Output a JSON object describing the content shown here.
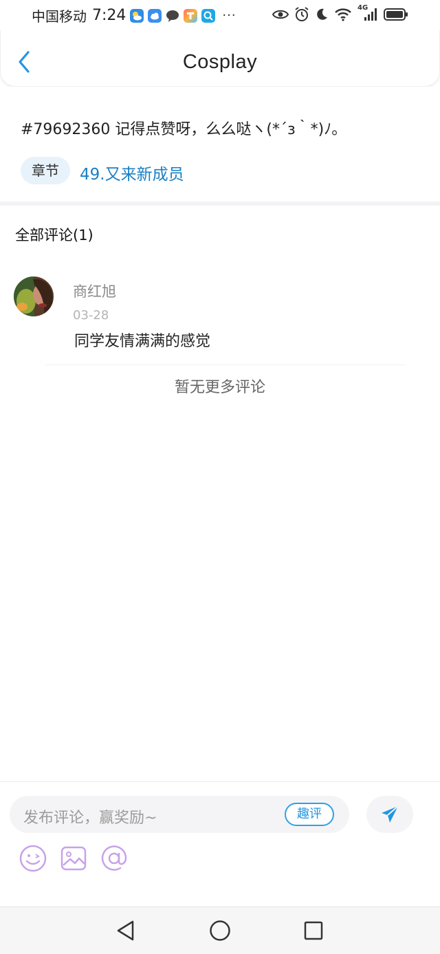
{
  "status_bar": {
    "carrier": "中国移动",
    "time": "7:24",
    "overflow": "···",
    "network": "4G"
  },
  "header": {
    "title": "Cosplay",
    "back_icon": "chevron-left-icon"
  },
  "post": {
    "text": "#79692360 记得点赞呀，么么哒ヽ(*´з｀*)ﾉ。",
    "chapter_tag": "章节",
    "chapter_link": "49.又来新成员"
  },
  "comments": {
    "title": "全部评论(1)",
    "items": [
      {
        "name": "商红旭",
        "date": "03-28",
        "text": "同学友情满满的感觉"
      }
    ],
    "no_more": "暂无更多评论"
  },
  "compose": {
    "placeholder": "发布评论，赢奖励~",
    "quick_comment": "趣评",
    "tools": [
      "emoji-icon",
      "image-icon",
      "mention-icon"
    ]
  },
  "colors": {
    "accent": "#1a7fc4",
    "send_blue": "#2196e0",
    "tool_purple": "#c8a2e8",
    "tag_bg": "#e8f2fb"
  }
}
